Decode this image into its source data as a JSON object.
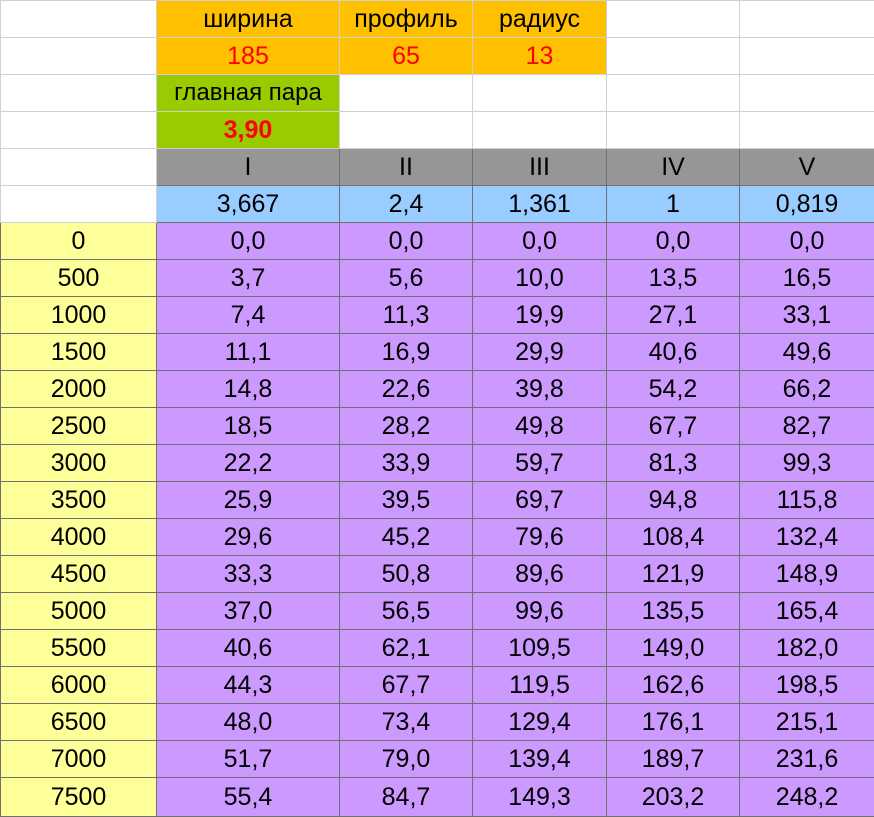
{
  "params": {
    "labels": [
      "ширина",
      "профиль",
      "радиус"
    ],
    "values": [
      "185",
      "65",
      "13"
    ]
  },
  "main_pair": {
    "label": "главная пара",
    "value": "3,90"
  },
  "gears": {
    "names": [
      "I",
      "II",
      "III",
      "IV",
      "V"
    ],
    "ratios": [
      "3,667",
      "2,4",
      "1,361",
      "1",
      "0,819"
    ]
  },
  "colors": {
    "orange": "#ffc000",
    "green": "#99cc00",
    "gray": "#969696",
    "blue": "#99ccff",
    "purple": "#cc99ff",
    "yellow": "#ffff99",
    "red": "#ff0000"
  },
  "rows": [
    {
      "rpm": "0",
      "speeds": [
        "0,0",
        "0,0",
        "0,0",
        "0,0",
        "0,0"
      ]
    },
    {
      "rpm": "500",
      "speeds": [
        "3,7",
        "5,6",
        "10,0",
        "13,5",
        "16,5"
      ]
    },
    {
      "rpm": "1000",
      "speeds": [
        "7,4",
        "11,3",
        "19,9",
        "27,1",
        "33,1"
      ]
    },
    {
      "rpm": "1500",
      "speeds": [
        "11,1",
        "16,9",
        "29,9",
        "40,6",
        "49,6"
      ]
    },
    {
      "rpm": "2000",
      "speeds": [
        "14,8",
        "22,6",
        "39,8",
        "54,2",
        "66,2"
      ]
    },
    {
      "rpm": "2500",
      "speeds": [
        "18,5",
        "28,2",
        "49,8",
        "67,7",
        "82,7"
      ]
    },
    {
      "rpm": "3000",
      "speeds": [
        "22,2",
        "33,9",
        "59,7",
        "81,3",
        "99,3"
      ]
    },
    {
      "rpm": "3500",
      "speeds": [
        "25,9",
        "39,5",
        "69,7",
        "94,8",
        "115,8"
      ]
    },
    {
      "rpm": "4000",
      "speeds": [
        "29,6",
        "45,2",
        "79,6",
        "108,4",
        "132,4"
      ]
    },
    {
      "rpm": "4500",
      "speeds": [
        "33,3",
        "50,8",
        "89,6",
        "121,9",
        "148,9"
      ]
    },
    {
      "rpm": "5000",
      "speeds": [
        "37,0",
        "56,5",
        "99,6",
        "135,5",
        "165,4"
      ]
    },
    {
      "rpm": "5500",
      "speeds": [
        "40,6",
        "62,1",
        "109,5",
        "149,0",
        "182,0"
      ]
    },
    {
      "rpm": "6000",
      "speeds": [
        "44,3",
        "67,7",
        "119,5",
        "162,6",
        "198,5"
      ]
    },
    {
      "rpm": "6500",
      "speeds": [
        "48,0",
        "73,4",
        "129,4",
        "176,1",
        "215,1"
      ]
    },
    {
      "rpm": "7000",
      "speeds": [
        "51,7",
        "79,0",
        "139,4",
        "189,7",
        "231,6"
      ]
    },
    {
      "rpm": "7500",
      "speeds": [
        "55,4",
        "84,7",
        "149,3",
        "203,2",
        "248,2"
      ]
    }
  ]
}
